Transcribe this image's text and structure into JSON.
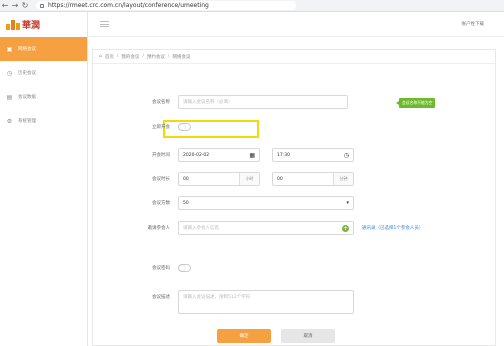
{
  "browser": {
    "url": "https://rmeet.crc.com.cn/layout/conference/umeeting"
  },
  "brand": {
    "name": "華潤"
  },
  "header": {
    "user": "账户姓下载"
  },
  "sidebar": {
    "items": [
      {
        "label": "网络会议",
        "icon": "video-icon",
        "active": true
      },
      {
        "label": "历史会议",
        "icon": "clock-icon",
        "active": false
      },
      {
        "label": "会议数据",
        "icon": "chart-icon",
        "active": false
      },
      {
        "label": "系统管理",
        "icon": "gear-icon",
        "active": false
      }
    ]
  },
  "breadcrumb": [
    "首页",
    "我的会议",
    "预约会议",
    "网络会议"
  ],
  "form": {
    "subject": {
      "label": "会议名称",
      "placeholder": "请输入会议名称（必填）",
      "tooltip": "会议名称不能为空"
    },
    "instant": {
      "label": "立即开会"
    },
    "start": {
      "label": "开会时间",
      "date": "2020-02-02",
      "time": "17:30"
    },
    "duration": {
      "label": "会议时长",
      "hours": "00",
      "hours_unit": "小时",
      "minutes": "00",
      "minutes_unit": "分钟"
    },
    "capacity": {
      "label": "会议方数",
      "value": "50"
    },
    "invite": {
      "label": "邀请参会人",
      "placeholder": "请输入参会人信息",
      "link": "通讯录（已选择1个参会人员）"
    },
    "password": {
      "label": "会议密码"
    },
    "description": {
      "label": "会议描述",
      "placeholder": "请输入会议描述，限制512个字符"
    }
  },
  "buttons": {
    "confirm": "确定",
    "cancel": "取消"
  },
  "colors": {
    "accent": "#f5a041",
    "highlight": "#f5d80a",
    "tooltip": "#6fba2c"
  }
}
